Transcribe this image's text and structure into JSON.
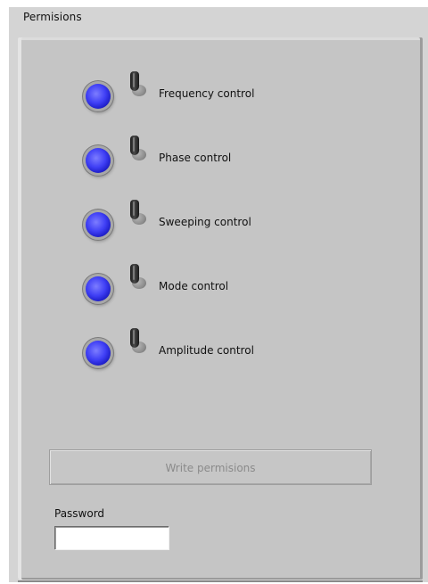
{
  "window": {
    "title": "Permisions"
  },
  "permissions": [
    {
      "label": "Frequency control"
    },
    {
      "label": "Phase control"
    },
    {
      "label": "Sweeping control"
    },
    {
      "label": "Mode control"
    },
    {
      "label": "Amplitude control"
    }
  ],
  "actions": {
    "write_label": "Write  permisions"
  },
  "password": {
    "label": "Password",
    "value": ""
  },
  "colors": {
    "led_on": "#3f3ff5",
    "panel": "#c5c5c5",
    "window": "#d4d4d4",
    "disabled_text": "#8b8b8b"
  }
}
